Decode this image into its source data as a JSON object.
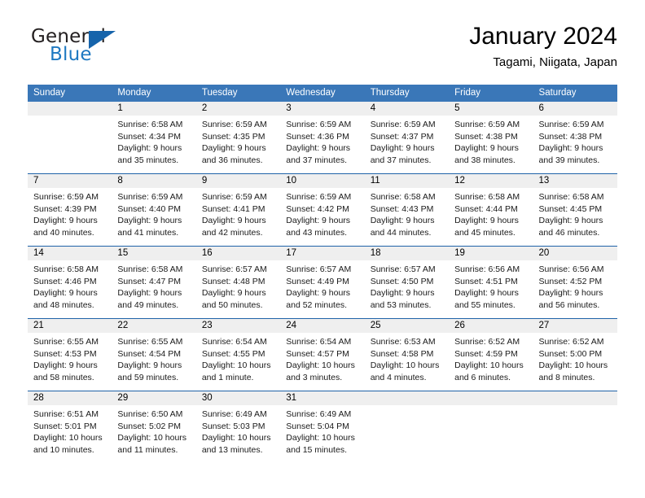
{
  "brand": {
    "name_top": "General",
    "name_bottom": "Blue",
    "triangle_color": "#1664ab",
    "blue_color": "#1d78c1"
  },
  "header": {
    "title": "January 2024",
    "subtitle": "Tagami, Niigata, Japan"
  },
  "theme": {
    "header_bg": "#3a77b8",
    "row_divider": "#1f63a8",
    "daynum_band": "#efefef"
  },
  "weekdays": [
    "Sunday",
    "Monday",
    "Tuesday",
    "Wednesday",
    "Thursday",
    "Friday",
    "Saturday"
  ],
  "weeks": [
    [
      {
        "day": ""
      },
      {
        "day": "1",
        "sunrise": "Sunrise: 6:58 AM",
        "sunset": "Sunset: 4:34 PM",
        "daylight1": "Daylight: 9 hours",
        "daylight2": "and 35 minutes."
      },
      {
        "day": "2",
        "sunrise": "Sunrise: 6:59 AM",
        "sunset": "Sunset: 4:35 PM",
        "daylight1": "Daylight: 9 hours",
        "daylight2": "and 36 minutes."
      },
      {
        "day": "3",
        "sunrise": "Sunrise: 6:59 AM",
        "sunset": "Sunset: 4:36 PM",
        "daylight1": "Daylight: 9 hours",
        "daylight2": "and 37 minutes."
      },
      {
        "day": "4",
        "sunrise": "Sunrise: 6:59 AM",
        "sunset": "Sunset: 4:37 PM",
        "daylight1": "Daylight: 9 hours",
        "daylight2": "and 37 minutes."
      },
      {
        "day": "5",
        "sunrise": "Sunrise: 6:59 AM",
        "sunset": "Sunset: 4:38 PM",
        "daylight1": "Daylight: 9 hours",
        "daylight2": "and 38 minutes."
      },
      {
        "day": "6",
        "sunrise": "Sunrise: 6:59 AM",
        "sunset": "Sunset: 4:38 PM",
        "daylight1": "Daylight: 9 hours",
        "daylight2": "and 39 minutes."
      }
    ],
    [
      {
        "day": "7",
        "sunrise": "Sunrise: 6:59 AM",
        "sunset": "Sunset: 4:39 PM",
        "daylight1": "Daylight: 9 hours",
        "daylight2": "and 40 minutes."
      },
      {
        "day": "8",
        "sunrise": "Sunrise: 6:59 AM",
        "sunset": "Sunset: 4:40 PM",
        "daylight1": "Daylight: 9 hours",
        "daylight2": "and 41 minutes."
      },
      {
        "day": "9",
        "sunrise": "Sunrise: 6:59 AM",
        "sunset": "Sunset: 4:41 PM",
        "daylight1": "Daylight: 9 hours",
        "daylight2": "and 42 minutes."
      },
      {
        "day": "10",
        "sunrise": "Sunrise: 6:59 AM",
        "sunset": "Sunset: 4:42 PM",
        "daylight1": "Daylight: 9 hours",
        "daylight2": "and 43 minutes."
      },
      {
        "day": "11",
        "sunrise": "Sunrise: 6:58 AM",
        "sunset": "Sunset: 4:43 PM",
        "daylight1": "Daylight: 9 hours",
        "daylight2": "and 44 minutes."
      },
      {
        "day": "12",
        "sunrise": "Sunrise: 6:58 AM",
        "sunset": "Sunset: 4:44 PM",
        "daylight1": "Daylight: 9 hours",
        "daylight2": "and 45 minutes."
      },
      {
        "day": "13",
        "sunrise": "Sunrise: 6:58 AM",
        "sunset": "Sunset: 4:45 PM",
        "daylight1": "Daylight: 9 hours",
        "daylight2": "and 46 minutes."
      }
    ],
    [
      {
        "day": "14",
        "sunrise": "Sunrise: 6:58 AM",
        "sunset": "Sunset: 4:46 PM",
        "daylight1": "Daylight: 9 hours",
        "daylight2": "and 48 minutes."
      },
      {
        "day": "15",
        "sunrise": "Sunrise: 6:58 AM",
        "sunset": "Sunset: 4:47 PM",
        "daylight1": "Daylight: 9 hours",
        "daylight2": "and 49 minutes."
      },
      {
        "day": "16",
        "sunrise": "Sunrise: 6:57 AM",
        "sunset": "Sunset: 4:48 PM",
        "daylight1": "Daylight: 9 hours",
        "daylight2": "and 50 minutes."
      },
      {
        "day": "17",
        "sunrise": "Sunrise: 6:57 AM",
        "sunset": "Sunset: 4:49 PM",
        "daylight1": "Daylight: 9 hours",
        "daylight2": "and 52 minutes."
      },
      {
        "day": "18",
        "sunrise": "Sunrise: 6:57 AM",
        "sunset": "Sunset: 4:50 PM",
        "daylight1": "Daylight: 9 hours",
        "daylight2": "and 53 minutes."
      },
      {
        "day": "19",
        "sunrise": "Sunrise: 6:56 AM",
        "sunset": "Sunset: 4:51 PM",
        "daylight1": "Daylight: 9 hours",
        "daylight2": "and 55 minutes."
      },
      {
        "day": "20",
        "sunrise": "Sunrise: 6:56 AM",
        "sunset": "Sunset: 4:52 PM",
        "daylight1": "Daylight: 9 hours",
        "daylight2": "and 56 minutes."
      }
    ],
    [
      {
        "day": "21",
        "sunrise": "Sunrise: 6:55 AM",
        "sunset": "Sunset: 4:53 PM",
        "daylight1": "Daylight: 9 hours",
        "daylight2": "and 58 minutes."
      },
      {
        "day": "22",
        "sunrise": "Sunrise: 6:55 AM",
        "sunset": "Sunset: 4:54 PM",
        "daylight1": "Daylight: 9 hours",
        "daylight2": "and 59 minutes."
      },
      {
        "day": "23",
        "sunrise": "Sunrise: 6:54 AM",
        "sunset": "Sunset: 4:55 PM",
        "daylight1": "Daylight: 10 hours",
        "daylight2": "and 1 minute."
      },
      {
        "day": "24",
        "sunrise": "Sunrise: 6:54 AM",
        "sunset": "Sunset: 4:57 PM",
        "daylight1": "Daylight: 10 hours",
        "daylight2": "and 3 minutes."
      },
      {
        "day": "25",
        "sunrise": "Sunrise: 6:53 AM",
        "sunset": "Sunset: 4:58 PM",
        "daylight1": "Daylight: 10 hours",
        "daylight2": "and 4 minutes."
      },
      {
        "day": "26",
        "sunrise": "Sunrise: 6:52 AM",
        "sunset": "Sunset: 4:59 PM",
        "daylight1": "Daylight: 10 hours",
        "daylight2": "and 6 minutes."
      },
      {
        "day": "27",
        "sunrise": "Sunrise: 6:52 AM",
        "sunset": "Sunset: 5:00 PM",
        "daylight1": "Daylight: 10 hours",
        "daylight2": "and 8 minutes."
      }
    ],
    [
      {
        "day": "28",
        "sunrise": "Sunrise: 6:51 AM",
        "sunset": "Sunset: 5:01 PM",
        "daylight1": "Daylight: 10 hours",
        "daylight2": "and 10 minutes."
      },
      {
        "day": "29",
        "sunrise": "Sunrise: 6:50 AM",
        "sunset": "Sunset: 5:02 PM",
        "daylight1": "Daylight: 10 hours",
        "daylight2": "and 11 minutes."
      },
      {
        "day": "30",
        "sunrise": "Sunrise: 6:49 AM",
        "sunset": "Sunset: 5:03 PM",
        "daylight1": "Daylight: 10 hours",
        "daylight2": "and 13 minutes."
      },
      {
        "day": "31",
        "sunrise": "Sunrise: 6:49 AM",
        "sunset": "Sunset: 5:04 PM",
        "daylight1": "Daylight: 10 hours",
        "daylight2": "and 15 minutes."
      },
      {
        "day": ""
      },
      {
        "day": ""
      },
      {
        "day": ""
      }
    ]
  ]
}
